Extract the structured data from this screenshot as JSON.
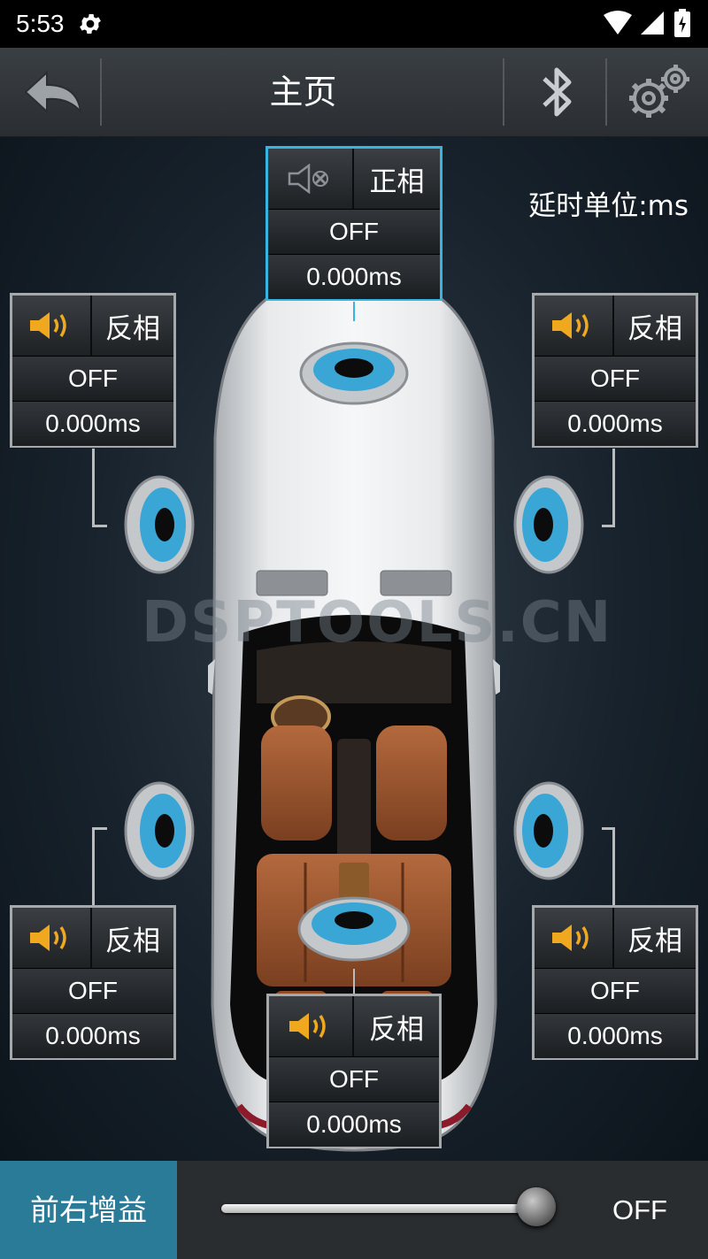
{
  "status_bar": {
    "time": "5:53"
  },
  "header": {
    "title": "主页"
  },
  "unit_label": "延时单位:ms",
  "watermark": "DSPTOOLS.CN",
  "channels": [
    {
      "position": "front-center",
      "muted": true,
      "phase": "正相",
      "state": "OFF",
      "delay": "0.000ms",
      "selected": true
    },
    {
      "position": "front-left",
      "muted": false,
      "phase": "反相",
      "state": "OFF",
      "delay": "0.000ms"
    },
    {
      "position": "front-right",
      "muted": false,
      "phase": "反相",
      "state": "OFF",
      "delay": "0.000ms"
    },
    {
      "position": "rear-left",
      "muted": false,
      "phase": "反相",
      "state": "OFF",
      "delay": "0.000ms"
    },
    {
      "position": "rear-right",
      "muted": false,
      "phase": "反相",
      "state": "OFF",
      "delay": "0.000ms"
    },
    {
      "position": "rear-center",
      "muted": false,
      "phase": "反相",
      "state": "OFF",
      "delay": "0.000ms"
    }
  ],
  "bottom": {
    "gain_label": "前右增益",
    "gain_value": "OFF",
    "gain_level": 1.0
  },
  "colors": {
    "accent": "#38b4e0",
    "speaker_icon": "#f0a81e",
    "gain_bg": "#2a7b98"
  }
}
